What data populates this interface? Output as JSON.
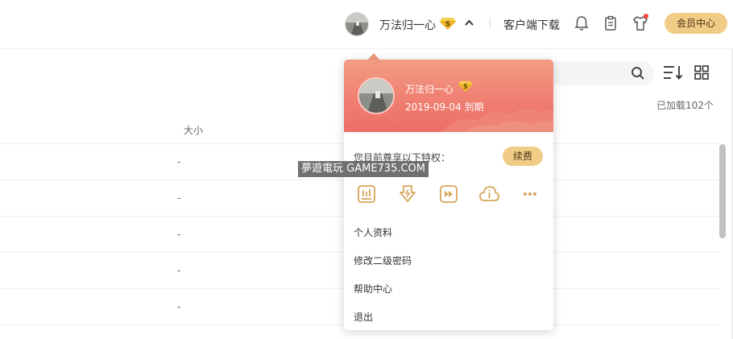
{
  "header": {
    "username": "万法归一心",
    "client_download": "客户端下载",
    "member_center": "会员中心",
    "vip_badge_letter": "S"
  },
  "toolbar": {
    "loaded_count": "已加载102个"
  },
  "table": {
    "col_size": "大小",
    "rows": [
      {
        "size": "-"
      },
      {
        "size": "-"
      },
      {
        "size": "-"
      },
      {
        "size": "-"
      },
      {
        "size": "-"
      }
    ]
  },
  "popup": {
    "username": "万法归一心",
    "expiry": "2019-09-04 到期",
    "privileges_label": "您目前尊享以下特权：",
    "renew_label": "续费",
    "privilege_icons": [
      "report-icon",
      "download-speed-icon",
      "fast-forward-icon",
      "cloud-info-icon",
      "more-icon"
    ],
    "menu": [
      "个人资料",
      "修改二级密码",
      "帮助中心",
      "退出"
    ]
  },
  "watermark": "夢遊電玩 GAME735.COM",
  "colors": {
    "gold": "#f1cc87",
    "popup_header": "#ef7d70",
    "icon_gold": "#d9a55a",
    "red_dot": "#f5453d"
  }
}
